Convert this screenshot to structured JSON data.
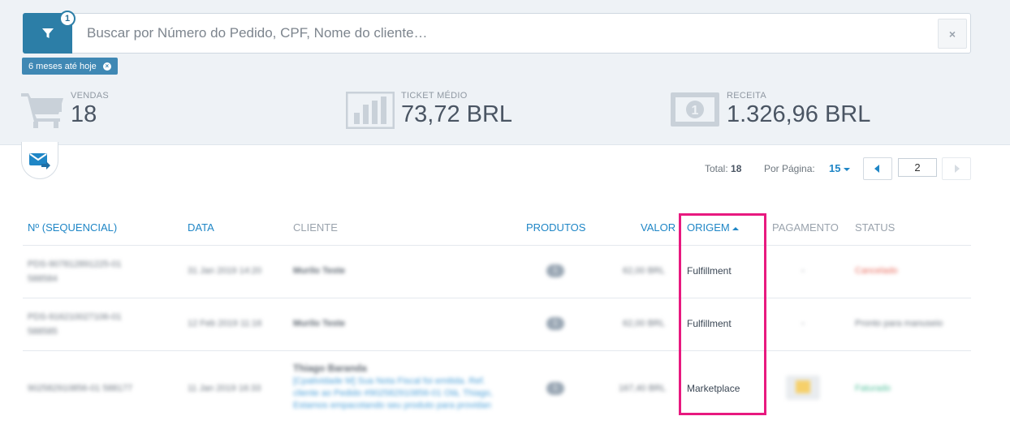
{
  "search": {
    "filter_count": "1",
    "placeholder": "Buscar por Número do Pedido, CPF, Nome do cliente…",
    "clear_symbol": "×",
    "chip_label": "6 meses até hoje",
    "chip_close_symbol": "×"
  },
  "stats": [
    {
      "icon": "cart-icon",
      "label": "VENDAS",
      "value": "18"
    },
    {
      "icon": "bar-chart-icon",
      "label": "TICKET MÉDIO",
      "value": "73,72 BRL"
    },
    {
      "icon": "banknote-icon",
      "label": "RECEITA",
      "value": "1.326,96 BRL"
    }
  ],
  "pagination": {
    "total_label": "Total:",
    "total_value": "18",
    "per_page_label": "Por Página:",
    "per_page_value": "15",
    "current_page": "2"
  },
  "table": {
    "headers": {
      "seq": "Nº (SEQUENCIAL)",
      "date": "DATA",
      "client": "CLIENTE",
      "products": "PRODUTOS",
      "value": "VALOR",
      "origin": "ORIGEM",
      "payment": "PAGAMENTO",
      "status": "STATUS"
    },
    "rows": [
      {
        "seq": "PDS-907812891225-01",
        "seq2": "588584",
        "date": "31 Jan 2019 14:20",
        "client": "Murilo Teste",
        "products": "1",
        "value": "62,00 BRL",
        "origin": "Fulfillment",
        "payment": "-",
        "status": "Cancelado",
        "status_color": "#e86a5c"
      },
      {
        "seq": "PDS-916210027106-01",
        "seq2": "588585",
        "date": "12 Feb 2019 11:16",
        "client": "Murilo Teste",
        "products": "1",
        "value": "62,00 BRL",
        "origin": "Fulfillment",
        "payment": "-",
        "status": "Pronto para manuseio",
        "status_color": "#6d7680"
      },
      {
        "seq": "902582910856-01 588177",
        "date": "11 Jan 2019 16:33",
        "client": "Thiago Baranda",
        "client_note": "[Cpatividade M] Sua Nota Fiscal foi emitida. Ref. cliente ao Pedido #902582910856-01 Olá, Thiago, Estamos empacotando seu produto para providan",
        "products": "1",
        "value": "167,40 BRL",
        "origin": "Marketplace",
        "payment": "",
        "status": "Faturado",
        "status_color": "#4fbf9a"
      }
    ]
  },
  "colors": {
    "primary": "#2c7ea7",
    "link": "#1f86c6",
    "highlight": "#e8197f"
  }
}
